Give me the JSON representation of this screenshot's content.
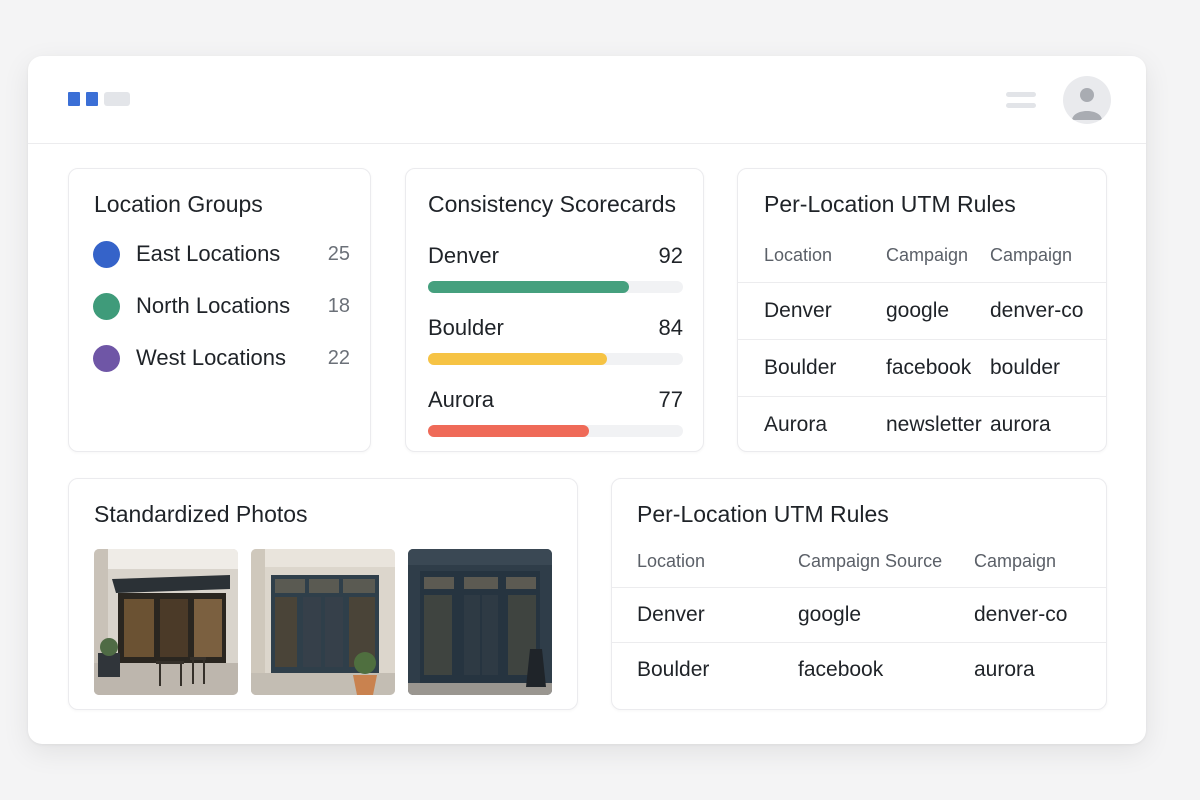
{
  "header": {
    "logo_icon": "brand-logo-icon",
    "menu_icon": "hamburger-menu-icon",
    "avatar_icon": "user-avatar-icon",
    "accent_color": "#3b6fd6"
  },
  "location_groups": {
    "title": "Location Groups",
    "items": [
      {
        "label": "East Locations",
        "count": "25",
        "color": "#3563c9"
      },
      {
        "label": "North Locations",
        "count": "18",
        "color": "#3f9b7a"
      },
      {
        "label": "West Locations",
        "count": "22",
        "color": "#6f56a6"
      }
    ]
  },
  "scorecards": {
    "title": "Consistency Scorecards",
    "items": [
      {
        "label": "Denver",
        "score": "92",
        "value": 0.79,
        "color": "#45a07e"
      },
      {
        "label": "Boulder",
        "score": "84",
        "value": 0.7,
        "color": "#f6c344"
      },
      {
        "label": "Aurora",
        "score": "77",
        "value": 0.63,
        "color": "#ef6a58"
      }
    ]
  },
  "utm_rules_top": {
    "title": "Per-Location UTM Rules",
    "columns": [
      "Location",
      "Campaign",
      "Campaign"
    ],
    "rows": [
      [
        "Denver",
        "google",
        "denver-co"
      ],
      [
        "Boulder",
        "facebook",
        "boulder"
      ],
      [
        "Aurora",
        "newsletter",
        "aurora"
      ]
    ]
  },
  "photos": {
    "title": "Standardized Photos",
    "items": [
      {
        "name": "storefront-photo-cafe"
      },
      {
        "name": "storefront-photo-doors"
      },
      {
        "name": "storefront-photo-dark"
      }
    ]
  },
  "utm_rules_bottom": {
    "title": "Per-Location UTM Rules",
    "columns": [
      "Location",
      "Campaign Source",
      "Campaign"
    ],
    "rows": [
      [
        "Denver",
        "google",
        "denver-co"
      ],
      [
        "Boulder",
        "facebook",
        "aurora"
      ]
    ]
  }
}
